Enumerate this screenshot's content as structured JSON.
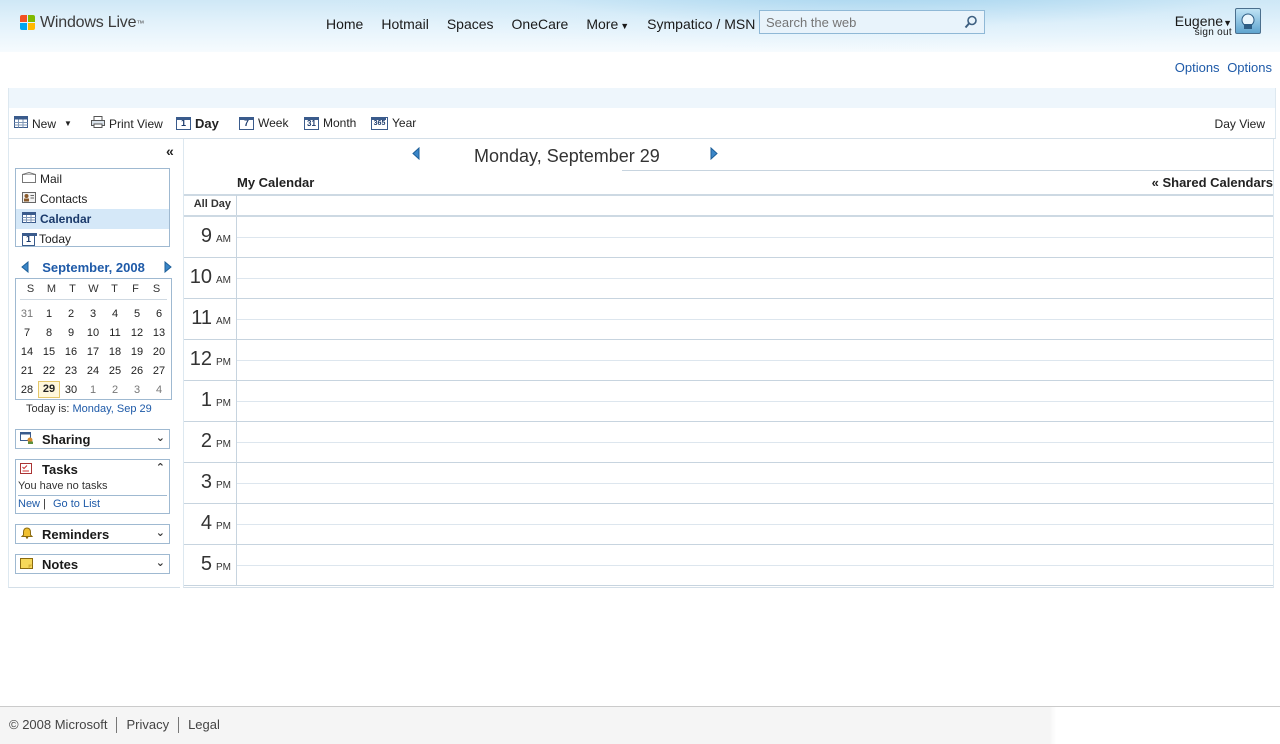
{
  "header": {
    "brand": "Windows Live",
    "tm": "™",
    "nav": [
      {
        "label": "Home"
      },
      {
        "label": "Hotmail"
      },
      {
        "label": "Spaces"
      },
      {
        "label": "OneCare"
      },
      {
        "label": "More"
      },
      {
        "label": "Sympatico / MSN"
      }
    ],
    "search_placeholder": "Search the web",
    "user_name": "Eugene",
    "sign_out": "sign out"
  },
  "options": {
    "label1": "Options",
    "label2": "Options"
  },
  "toolbar": {
    "new": "New",
    "print_view": "Print View",
    "day": "Day",
    "week": "Week",
    "month": "Month",
    "year": "Year",
    "day_icon": "1",
    "week_icon": "7",
    "month_icon": "31",
    "year_icon": "365",
    "current_view": "Day View"
  },
  "appnav": [
    {
      "label": "Mail"
    },
    {
      "label": "Contacts"
    },
    {
      "label": "Calendar"
    },
    {
      "label": "Today"
    }
  ],
  "minical": {
    "title": "September, 2008",
    "weekdays": [
      "S",
      "M",
      "T",
      "W",
      "T",
      "F",
      "S"
    ],
    "weeks": [
      [
        "31",
        "1",
        "2",
        "3",
        "4",
        "5",
        "6"
      ],
      [
        "7",
        "8",
        "9",
        "10",
        "11",
        "12",
        "13"
      ],
      [
        "14",
        "15",
        "16",
        "17",
        "18",
        "19",
        "20"
      ],
      [
        "21",
        "22",
        "23",
        "24",
        "25",
        "26",
        "27"
      ],
      [
        "28",
        "29",
        "30",
        "1",
        "2",
        "3",
        "4"
      ]
    ],
    "today_label": "Today is:",
    "today_link": "Monday, Sep 29"
  },
  "panels": {
    "sharing": "Sharing",
    "tasks": "Tasks",
    "tasks_empty": "You have no tasks",
    "tasks_new": "New",
    "tasks_sep": "|",
    "tasks_list": "Go to List",
    "reminders": "Reminders",
    "notes": "Notes"
  },
  "calendar": {
    "date": "Monday, September 29",
    "my_calendar": "My Calendar",
    "shared_calendars": "Shared Calendars",
    "all_day": "All Day",
    "hours": [
      {
        "h": "9",
        "ap": "AM"
      },
      {
        "h": "10",
        "ap": "AM"
      },
      {
        "h": "11",
        "ap": "AM"
      },
      {
        "h": "12",
        "ap": "PM"
      },
      {
        "h": "1",
        "ap": "PM"
      },
      {
        "h": "2",
        "ap": "PM"
      },
      {
        "h": "3",
        "ap": "PM"
      },
      {
        "h": "4",
        "ap": "PM"
      },
      {
        "h": "5",
        "ap": "PM"
      }
    ]
  },
  "footer": {
    "copyright": "© 2008 Microsoft",
    "privacy": "Privacy",
    "legal": "Legal"
  }
}
